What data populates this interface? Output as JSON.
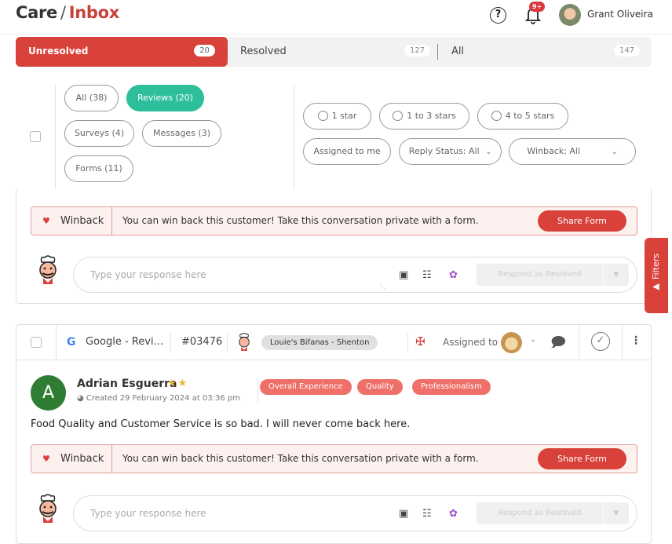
{
  "header": {
    "title_main": "Care",
    "title_sep": "/",
    "title_page": "Inbox",
    "help_glyph": "?",
    "notif_badge": "9+",
    "user_name": "Grant Oliveira"
  },
  "tabs": [
    {
      "label": "Unresolved",
      "count": "20"
    },
    {
      "label": "Resolved",
      "count": "127"
    },
    {
      "label": "All",
      "count": "147"
    }
  ],
  "filters": {
    "types": [
      "All (38)",
      "Reviews (20)",
      "Surveys (4)",
      "Messages (3)",
      "Forms (11)"
    ],
    "ratings": [
      "1 star",
      "1 to 3 stars",
      "4 to 5 stars"
    ],
    "assigned": "Assigned to me",
    "reply_status": "Reply Status: All",
    "winback": "Winback: All"
  },
  "winback": {
    "label": "Winback",
    "message": "You can win back this customer! Take this conversation private with a form.",
    "button": "Share Form"
  },
  "response": {
    "placeholder": "Type your response here",
    "button": "Respond as Resolved"
  },
  "filters_tab": "Filters",
  "conversation": {
    "source": "Google - Revi...",
    "ticket": "#03476",
    "location": "Louie's Bifanas - Shenton",
    "assigned_label": "Assigned to",
    "reviewer_initial": "A",
    "reviewer_name": "Adrian Esguerra",
    "stars": 2,
    "created": "Created 29 February 2024 at 03:36 pm",
    "topics": [
      "Overall Experience",
      "Quality",
      "Professionalism"
    ],
    "review_text": "Food Quality and Customer Service is so bad. I will never come back here."
  },
  "colors": {
    "accent": "#d9413b",
    "active_pill": "#2dbf9b",
    "topic_tag": "#ef6f69",
    "star": "#e8b92a"
  }
}
